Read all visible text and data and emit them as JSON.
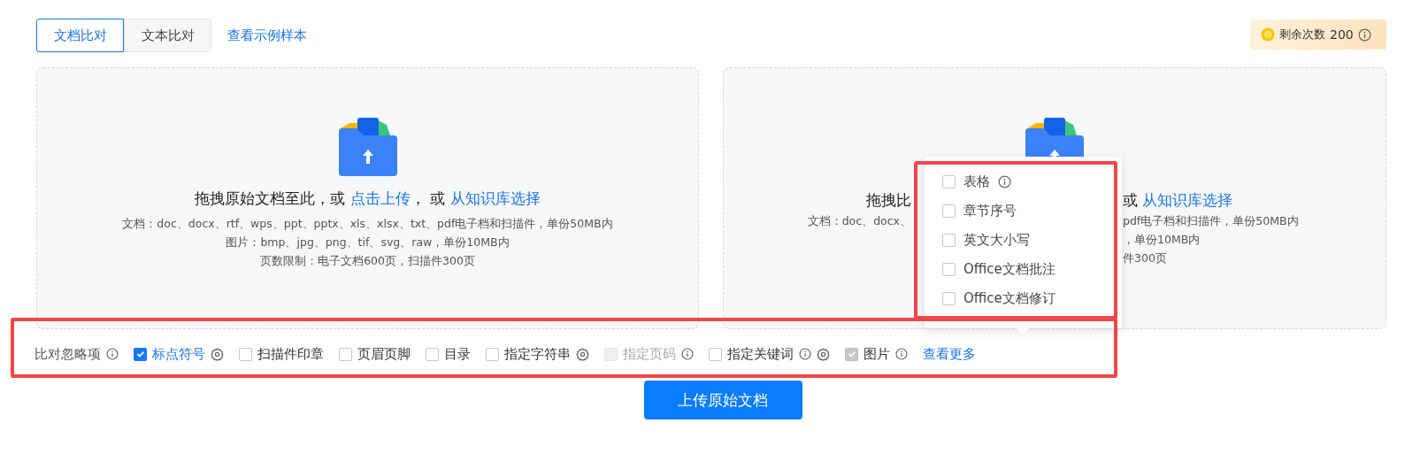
{
  "tabs": [
    {
      "label": "文档比对",
      "selected": true
    },
    {
      "label": "文本比对",
      "selected": false
    }
  ],
  "sample_link": "查看示例样本",
  "quota": {
    "label": "剩余次数",
    "count": "200"
  },
  "upload_panels": [
    {
      "kind": "full",
      "prompt": "拖拽原始文档至此，或 ",
      "upload_link": "点击上传",
      "separator": "，  或 ",
      "library_link": "从知识库选择",
      "notes": [
        "文档：doc、docx、rtf、wps、ppt、pptx、xls、xlsx、txt、pdf电子档和扫描件，单份50MB内",
        "图片：bmp、jpg、png、tif、svg、raw，单份10MB内",
        "页数限制：电子文档600页，扫描件300页"
      ]
    },
    {
      "kind": "partial",
      "lines": [
        {
          "left": "拖拽比",
          "right": "或 ",
          "link": "从知识库选择"
        },
        {
          "left": "文档：doc、docx、",
          "right": "pdf电子档和扫描件，单份50MB内"
        },
        {
          "right": "，单份10MB内"
        },
        {
          "right": "件300页"
        }
      ]
    }
  ],
  "ignore_bar": {
    "highlighted": true,
    "label": "比对忽略项",
    "options": [
      {
        "label": "标点符号",
        "checked": true,
        "disabled": false,
        "info": false,
        "settings": true
      },
      {
        "label": "扫描件印章",
        "checked": false,
        "disabled": false,
        "info": false,
        "settings": false
      },
      {
        "label": "页眉页脚",
        "checked": false,
        "disabled": false,
        "info": false,
        "settings": false
      },
      {
        "label": "目录",
        "checked": false,
        "disabled": false,
        "info": false,
        "settings": false
      },
      {
        "label": "指定字符串",
        "checked": false,
        "disabled": false,
        "info": false,
        "settings": true
      },
      {
        "label": "指定页码",
        "checked": false,
        "disabled": true,
        "info": true,
        "settings": false
      },
      {
        "label": "指定关键词",
        "checked": false,
        "disabled": false,
        "info": true,
        "settings": true
      },
      {
        "label": "图片",
        "checked": true,
        "disabled": true,
        "info": true,
        "settings": false
      }
    ],
    "more_link": "查看更多"
  },
  "more_popover": {
    "highlighted": true,
    "options": [
      {
        "label": "表格",
        "checked": false,
        "info": true
      },
      {
        "label": "章节序号",
        "checked": false,
        "info": false
      },
      {
        "label": "英文大小写",
        "checked": false,
        "info": false
      },
      {
        "label": "Office文档批注",
        "checked": false,
        "info": false
      },
      {
        "label": "Office文档修订",
        "checked": false,
        "info": false
      }
    ]
  },
  "upload_button": "上传原始文档"
}
